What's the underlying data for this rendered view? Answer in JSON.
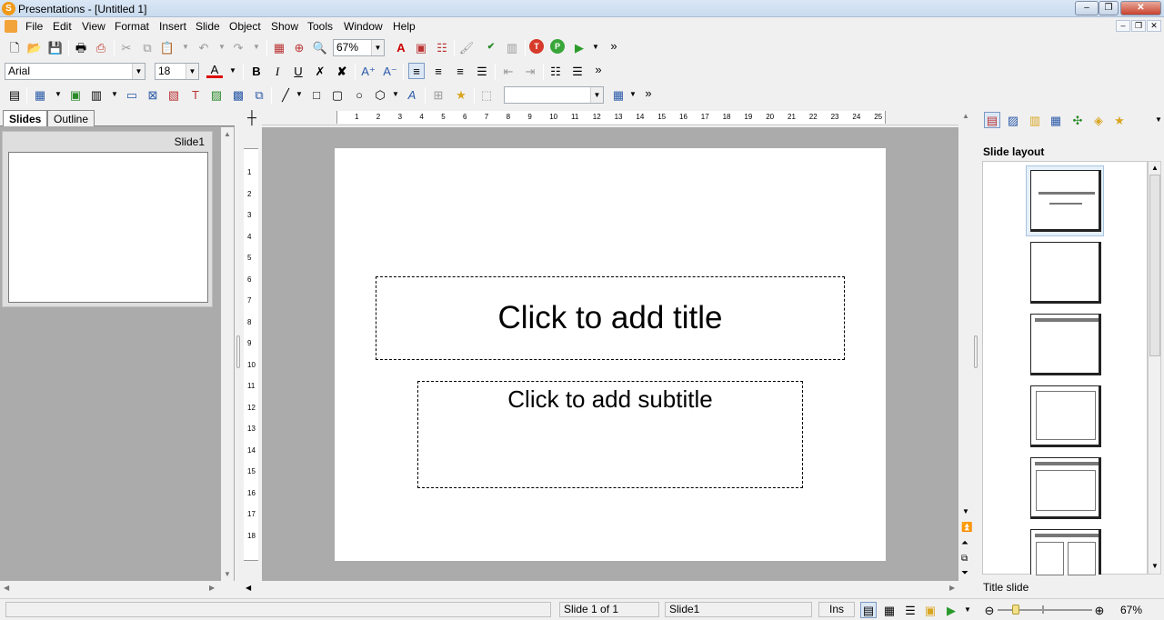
{
  "window": {
    "title": "Presentations - [Untitled 1]",
    "app_icon": "S"
  },
  "menu": [
    "File",
    "Edit",
    "View",
    "Format",
    "Insert",
    "Slide",
    "Object",
    "Show",
    "Tools",
    "Window",
    "Help"
  ],
  "toolbar1": {
    "zoom": "67%"
  },
  "toolbar2": {
    "font": "Arial",
    "size": "18"
  },
  "toolbar3": {
    "combo": ""
  },
  "tabs": {
    "slides": "Slides",
    "outline": "Outline"
  },
  "thumbnail": {
    "label": "Slide1"
  },
  "ruler": {
    "h": [
      "1",
      "2",
      "3",
      "4",
      "5",
      "6",
      "7",
      "8",
      "9",
      "10",
      "11",
      "12",
      "13",
      "14",
      "15",
      "16",
      "17",
      "18",
      "19",
      "20",
      "21",
      "22",
      "23",
      "24",
      "25"
    ],
    "v": [
      "1",
      "2",
      "3",
      "4",
      "5",
      "6",
      "7",
      "8",
      "9",
      "10",
      "11",
      "12",
      "13",
      "14",
      "15",
      "16",
      "17",
      "18"
    ]
  },
  "slide": {
    "title_placeholder": "Click to add title",
    "subtitle_placeholder": "Click to add subtitle"
  },
  "sidepanel": {
    "heading": "Slide layout",
    "selected_layout": "Title slide"
  },
  "status": {
    "slide_pos": "Slide 1 of 1",
    "slide_name": "Slide1",
    "mode": "Ins",
    "zoom": "67%"
  },
  "icons": [
    "new-icon",
    "open-icon",
    "save-icon",
    "print-icon",
    "cut-icon",
    "copy-icon",
    "paste-icon",
    "undo-icon",
    "redo-icon",
    "zoom-icon",
    "spellcheck-icon",
    "play-icon",
    "bold-icon",
    "italic-icon",
    "underline-icon",
    "strikethrough-icon",
    "align-left-icon",
    "bullets-icon",
    "table-icon",
    "rectangle-icon",
    "ellipse-icon",
    "star-icon"
  ]
}
